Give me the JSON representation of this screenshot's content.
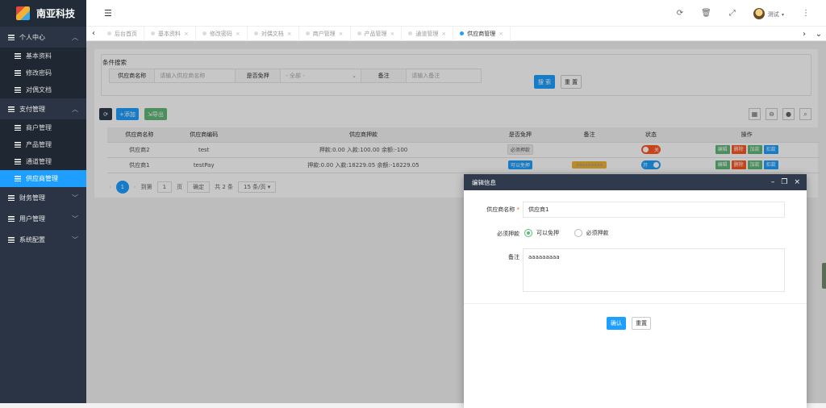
{
  "brand": {
    "name": "南亚科技"
  },
  "sidebar": {
    "groups": [
      {
        "label": "个人中心",
        "items": [
          "基本资料",
          "修改密码",
          "对偶文档"
        ]
      },
      {
        "label": "支付管理",
        "items": [
          "商户管理",
          "产品管理",
          "通道管理",
          "供应商管理"
        ]
      },
      {
        "label": "财务管理"
      },
      {
        "label": "用户管理"
      },
      {
        "label": "系统配置"
      }
    ]
  },
  "header": {
    "user": "测试"
  },
  "tabs": [
    "后台首页",
    "基本资料",
    "修改密码",
    "对偶文档",
    "商户管理",
    "产品管理",
    "通道管理",
    "供应商管理"
  ],
  "search": {
    "legend": "条件搜索",
    "name_label": "供应商名称",
    "name_placeholder": "请输入供应商名称",
    "exempt_label": "是否免押",
    "exempt_value": "- 全部 -",
    "remark_label": "备注",
    "remark_placeholder": "请输入备注",
    "search_btn": "搜 索",
    "reset_btn": "重 置"
  },
  "toolbar": {
    "add": "添加",
    "export": "导出"
  },
  "table": {
    "headers": [
      "供应商名称",
      "供应商编码",
      "供应商押款",
      "是否免押",
      "备注",
      "状态",
      "操作"
    ],
    "rows": [
      {
        "name": "供应商2",
        "code": "test",
        "deposit": "押款:0.00 入款:100.00 余额:-100",
        "exempt": "必须押款",
        "remark": "",
        "status": "关"
      },
      {
        "name": "供应商1",
        "code": "testPay",
        "deposit": "押款:0.00 入款:18229.05 余额:-18229.05",
        "exempt": "可以免押",
        "remark": "aaaaaaaaa",
        "status": "开"
      }
    ],
    "ops": [
      "编辑",
      "删除",
      "加款",
      "扣款"
    ]
  },
  "pager": {
    "page": "1",
    "goto": "到第",
    "goto_val": "1",
    "page_unit": "页",
    "confirm": "确定",
    "total": "共 2 条",
    "size": "15 条/页"
  },
  "modal": {
    "title": "编辑信息",
    "name_label": "供应商名称",
    "name_value": "供应商1",
    "exempt_label": "必须押款",
    "opt1": "可以免押",
    "opt2": "必须押款",
    "remark_label": "备注",
    "remark_value": "aaaaaaaaa",
    "confirm": "确认",
    "reset": "重置"
  },
  "colors": {
    "accent": "#1e9fff",
    "sidebar": "#2a3444",
    "danger": "#ff5722",
    "success": "#5fb878"
  }
}
